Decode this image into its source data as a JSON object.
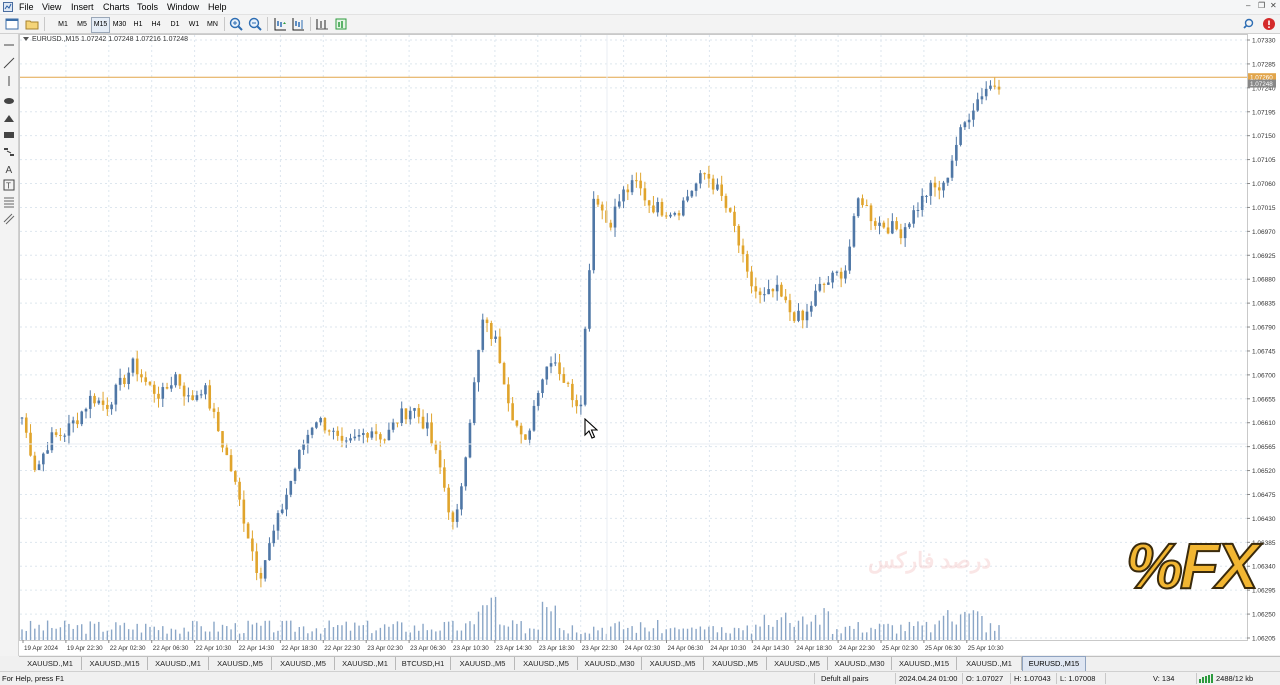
{
  "menu": {
    "items": [
      "File",
      "View",
      "Insert",
      "Charts",
      "Tools",
      "Window",
      "Help"
    ]
  },
  "toolbar": {
    "timeframes": [
      "M1",
      "M5",
      "M15",
      "M30",
      "H1",
      "H4",
      "D1",
      "W1",
      "MN"
    ],
    "active_timeframe": "M15"
  },
  "chart": {
    "header": "EURUSD.,M15  1.07242 1.07248 1.07216 1.07248",
    "price_labels": [
      "1.07330",
      "1.07285",
      "1.07240",
      "1.07195",
      "1.07150",
      "1.07105",
      "1.07060",
      "1.07015",
      "1.06970",
      "1.06925",
      "1.06880",
      "1.06835",
      "1.06790",
      "1.06745",
      "1.06700",
      "1.06655",
      "1.06610",
      "1.06565",
      "1.06520",
      "1.06475",
      "1.06430",
      "1.06385",
      "1.06340",
      "1.06295",
      "1.06250",
      "1.06205"
    ],
    "current_price_labels": [
      "1.07260",
      "1.07248"
    ],
    "time_labels": [
      "19 Apr 2024",
      "19 Apr 22:30",
      "22 Apr 02:30",
      "22 Apr 06:30",
      "22 Apr 10:30",
      "22 Apr 14:30",
      "22 Apr 18:30",
      "22 Apr 22:30",
      "23 Apr 02:30",
      "23 Apr 06:30",
      "23 Apr 10:30",
      "23 Apr 14:30",
      "23 Apr 18:30",
      "23 Apr 22:30",
      "24 Apr 02:30",
      "24 Apr 06:30",
      "24 Apr 10:30",
      "24 Apr 14:30",
      "24 Apr 18:30",
      "24 Apr 22:30",
      "25 Apr 02:30",
      "25 Apr 06:30",
      "25 Apr 10:30"
    ],
    "colors": {
      "bull": "#4f77a6",
      "bear": "#e0a42c",
      "hline": "#e2a54a",
      "grid": "#dde6ee",
      "volume": "#8aa6c7"
    }
  },
  "chart_data": {
    "type": "candlestick",
    "title": "EURUSD.,M15",
    "symbol": "EURUSD.",
    "timeframe": "M15",
    "ohlc_last": {
      "open": 1.07242,
      "high": 1.07248,
      "low": 1.07216,
      "close": 1.07248
    },
    "ylim": [
      1.06205,
      1.0733
    ],
    "price_path": [
      1.0662,
      1.0652,
      1.0658,
      1.0659,
      1.0662,
      1.0666,
      1.0664,
      1.0668,
      1.0672,
      1.0668,
      1.0666,
      1.067,
      1.0665,
      1.0668,
      1.066,
      1.0652,
      1.0642,
      1.0632,
      1.064,
      1.0648,
      1.0656,
      1.0662,
      1.066,
      1.0656,
      1.0658,
      1.066,
      1.0658,
      1.0662,
      1.0664,
      1.066,
      1.0652,
      1.064,
      1.066,
      1.068,
      1.0676,
      1.0664,
      1.0656,
      1.0668,
      1.0674,
      1.0668,
      1.0664,
      1.0705,
      1.0698,
      1.0704,
      1.0706,
      1.0702,
      1.0701,
      1.0701,
      1.0705,
      1.0708,
      1.0704,
      1.0698,
      1.0688,
      1.0684,
      1.0686,
      1.0682,
      1.068,
      1.0686,
      1.0688,
      1.069,
      1.0704,
      1.0699,
      1.0698,
      1.0697,
      1.0701,
      1.0705,
      1.0705,
      1.0714,
      1.072,
      1.0724,
      1.0725
    ],
    "volume_level": "low with spikes near 23 Apr 10:30 and 23 Apr 14:30",
    "horizontal_line": 1.0726,
    "grid": true
  },
  "tabs": [
    "XAUUSD.,M1",
    "XAUUSD.,M15",
    "XAUUSD.,M1",
    "XAUUSD.,M5",
    "XAUUSD.,M5",
    "XAUUSD.,M1",
    "BTCUSD,H1",
    "XAUUSD.,M5",
    "XAUUSD.,M5",
    "XAUUSD.,M30",
    "XAUUSD.,M5",
    "XAUUSD.,M5",
    "XAUUSD.,M5",
    "XAUUSD.,M30",
    "XAUUSD.,M15",
    "XAUUSD.,M1",
    "EURUSD.,M15"
  ],
  "active_tab": "EURUSD.,M15",
  "status": {
    "help": "For Help, press F1",
    "profile": "Defult all pairs",
    "datetime": "2024.04.24 01:00",
    "open": "O: 1.07027",
    "high": "H: 1.07043",
    "low": "L: 1.07008",
    "volume": "V: 134",
    "traffic": "2488/12 kb"
  },
  "watermark": {
    "text": "%FX",
    "text_fa": "درصد فارکس"
  }
}
